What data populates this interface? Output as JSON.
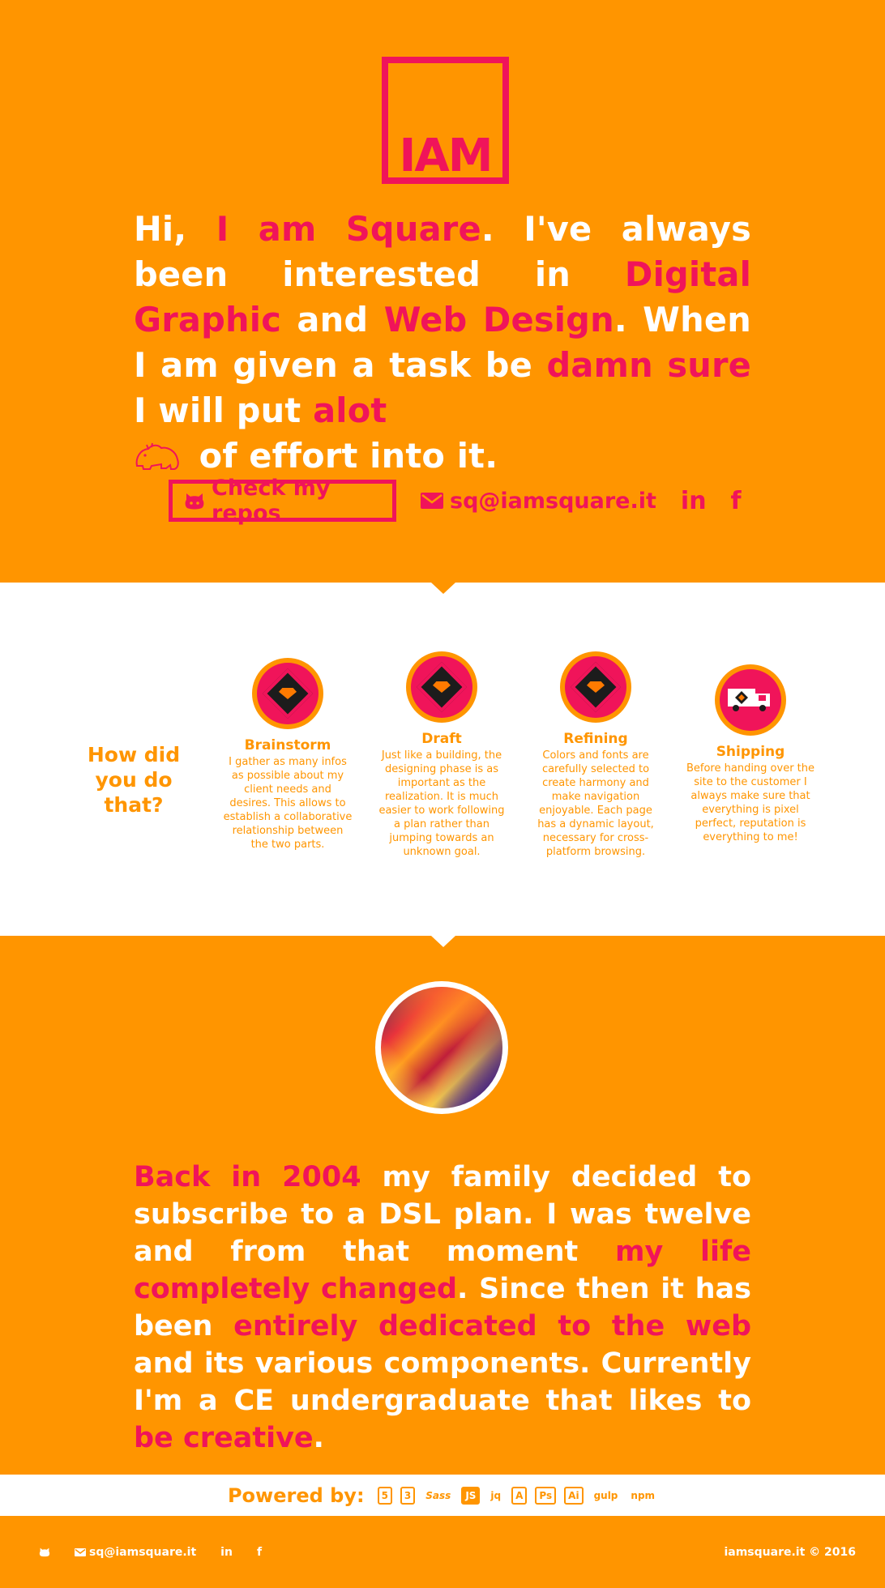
{
  "colors": {
    "orange": "#ff9500",
    "pink": "#f0145a",
    "white": "#ffffff"
  },
  "logo": {
    "text": "IAM"
  },
  "intro": {
    "segments": [
      {
        "text": "Hi, ",
        "accent": false
      },
      {
        "text": "I am Square",
        "accent": true
      },
      {
        "text": ". I've always been interested in ",
        "accent": false
      },
      {
        "text": "Digital Graphic",
        "accent": true
      },
      {
        "text": " and ",
        "accent": false
      },
      {
        "text": "Web Design",
        "accent": true
      },
      {
        "text": ". When I am given a task be ",
        "accent": false
      },
      {
        "text": "damn sure",
        "accent": true
      },
      {
        "text": " I will put ",
        "accent": false
      },
      {
        "text": "alot",
        "accent": true
      },
      {
        "text": " of effort into it.",
        "accent": false
      }
    ],
    "inline_icon": "hippo-icon"
  },
  "links": {
    "repos_label": "Check my repos",
    "repos_icon": "github-icon",
    "email": "sq@iamsquare.it",
    "email_icon": "envelope-icon",
    "linkedin": "in",
    "facebook": "f"
  },
  "process": {
    "heading": "How did you do that?",
    "steps": [
      {
        "title": "Brainstorm",
        "text": "I gather as many infos as possible about my client needs and desires. This allows to establish a collaborative relationship between the two parts.",
        "icon": "sketch-diamond-icon"
      },
      {
        "title": "Draft",
        "text": "Just like a building, the designing phase is as important as the realization. It is much easier to work following a plan rather than jumping towards an unknown goal.",
        "icon": "sketch-diamond-icon"
      },
      {
        "title": "Refining",
        "text": "Colors and fonts are carefully selected to create harmony and make navigation enjoyable. Each page has a dynamic layout, necessary for cross-platform browsing.",
        "icon": "sketch-diamond-icon"
      },
      {
        "title": "Shipping",
        "text": "Before handing over the site to the customer I always make sure that everything is pixel perfect, reputation is everything to me!",
        "icon": "truck-icon"
      }
    ]
  },
  "about": {
    "avatar_icon": "avatar-image",
    "segments": [
      {
        "text": "Back in 2004",
        "accent": true
      },
      {
        "text": " my family decided to subscribe to a DSL plan. I was twelve and from that moment ",
        "accent": false
      },
      {
        "text": "my life completely changed",
        "accent": true
      },
      {
        "text": ". Since then it has been ",
        "accent": false
      },
      {
        "text": "entirely dedicated to the web",
        "accent": true
      },
      {
        "text": " and its various components. Currently I'm a CE undergraduate that likes to ",
        "accent": false
      },
      {
        "text": "be creative",
        "accent": true
      },
      {
        "text": ".",
        "accent": false
      }
    ]
  },
  "powered": {
    "label": "Powered by:",
    "techs": [
      "html5-icon",
      "css3-icon",
      "sass-icon",
      "js-icon",
      "jquery-icon",
      "angular-icon",
      "photoshop-icon",
      "illustrator-icon",
      "gulp-icon",
      "npm-icon"
    ],
    "tech_labels": [
      "5",
      "3",
      "Sass",
      "JS",
      "jq",
      "A",
      "Ps",
      "Ai",
      "gulp",
      "npm"
    ]
  },
  "footer": {
    "email": "sq@iamsquare.it",
    "linkedin": "in",
    "facebook": "f",
    "copyright": "iamsquare.it © 2016"
  }
}
